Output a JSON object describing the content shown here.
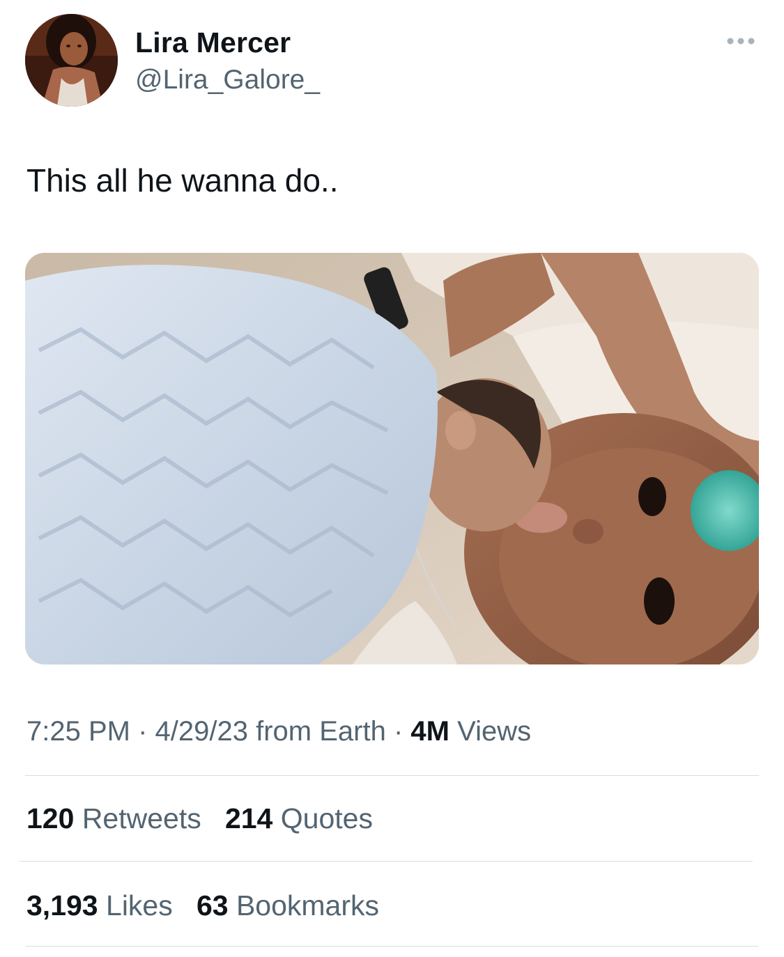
{
  "author": {
    "name": "Lira Mercer",
    "handle": "@Lira_Galore_"
  },
  "more_icon": "more-horizontal-icon",
  "tweet": {
    "text": "This all he wanna do.."
  },
  "meta": {
    "time": "7:25 PM",
    "separator": "·",
    "date_source": "4/29/23 from Earth",
    "views_count": "4M",
    "views_label": "Views"
  },
  "stats": {
    "retweets_count": "120",
    "retweets_label": "Retweets",
    "quotes_count": "214",
    "quotes_label": "Quotes",
    "likes_count": "3,193",
    "likes_label": "Likes",
    "bookmarks_count": "63",
    "bookmarks_label": "Bookmarks"
  },
  "colors": {
    "text_primary": "#0f1419",
    "text_secondary": "#536471",
    "divider": "#d9dde1"
  }
}
